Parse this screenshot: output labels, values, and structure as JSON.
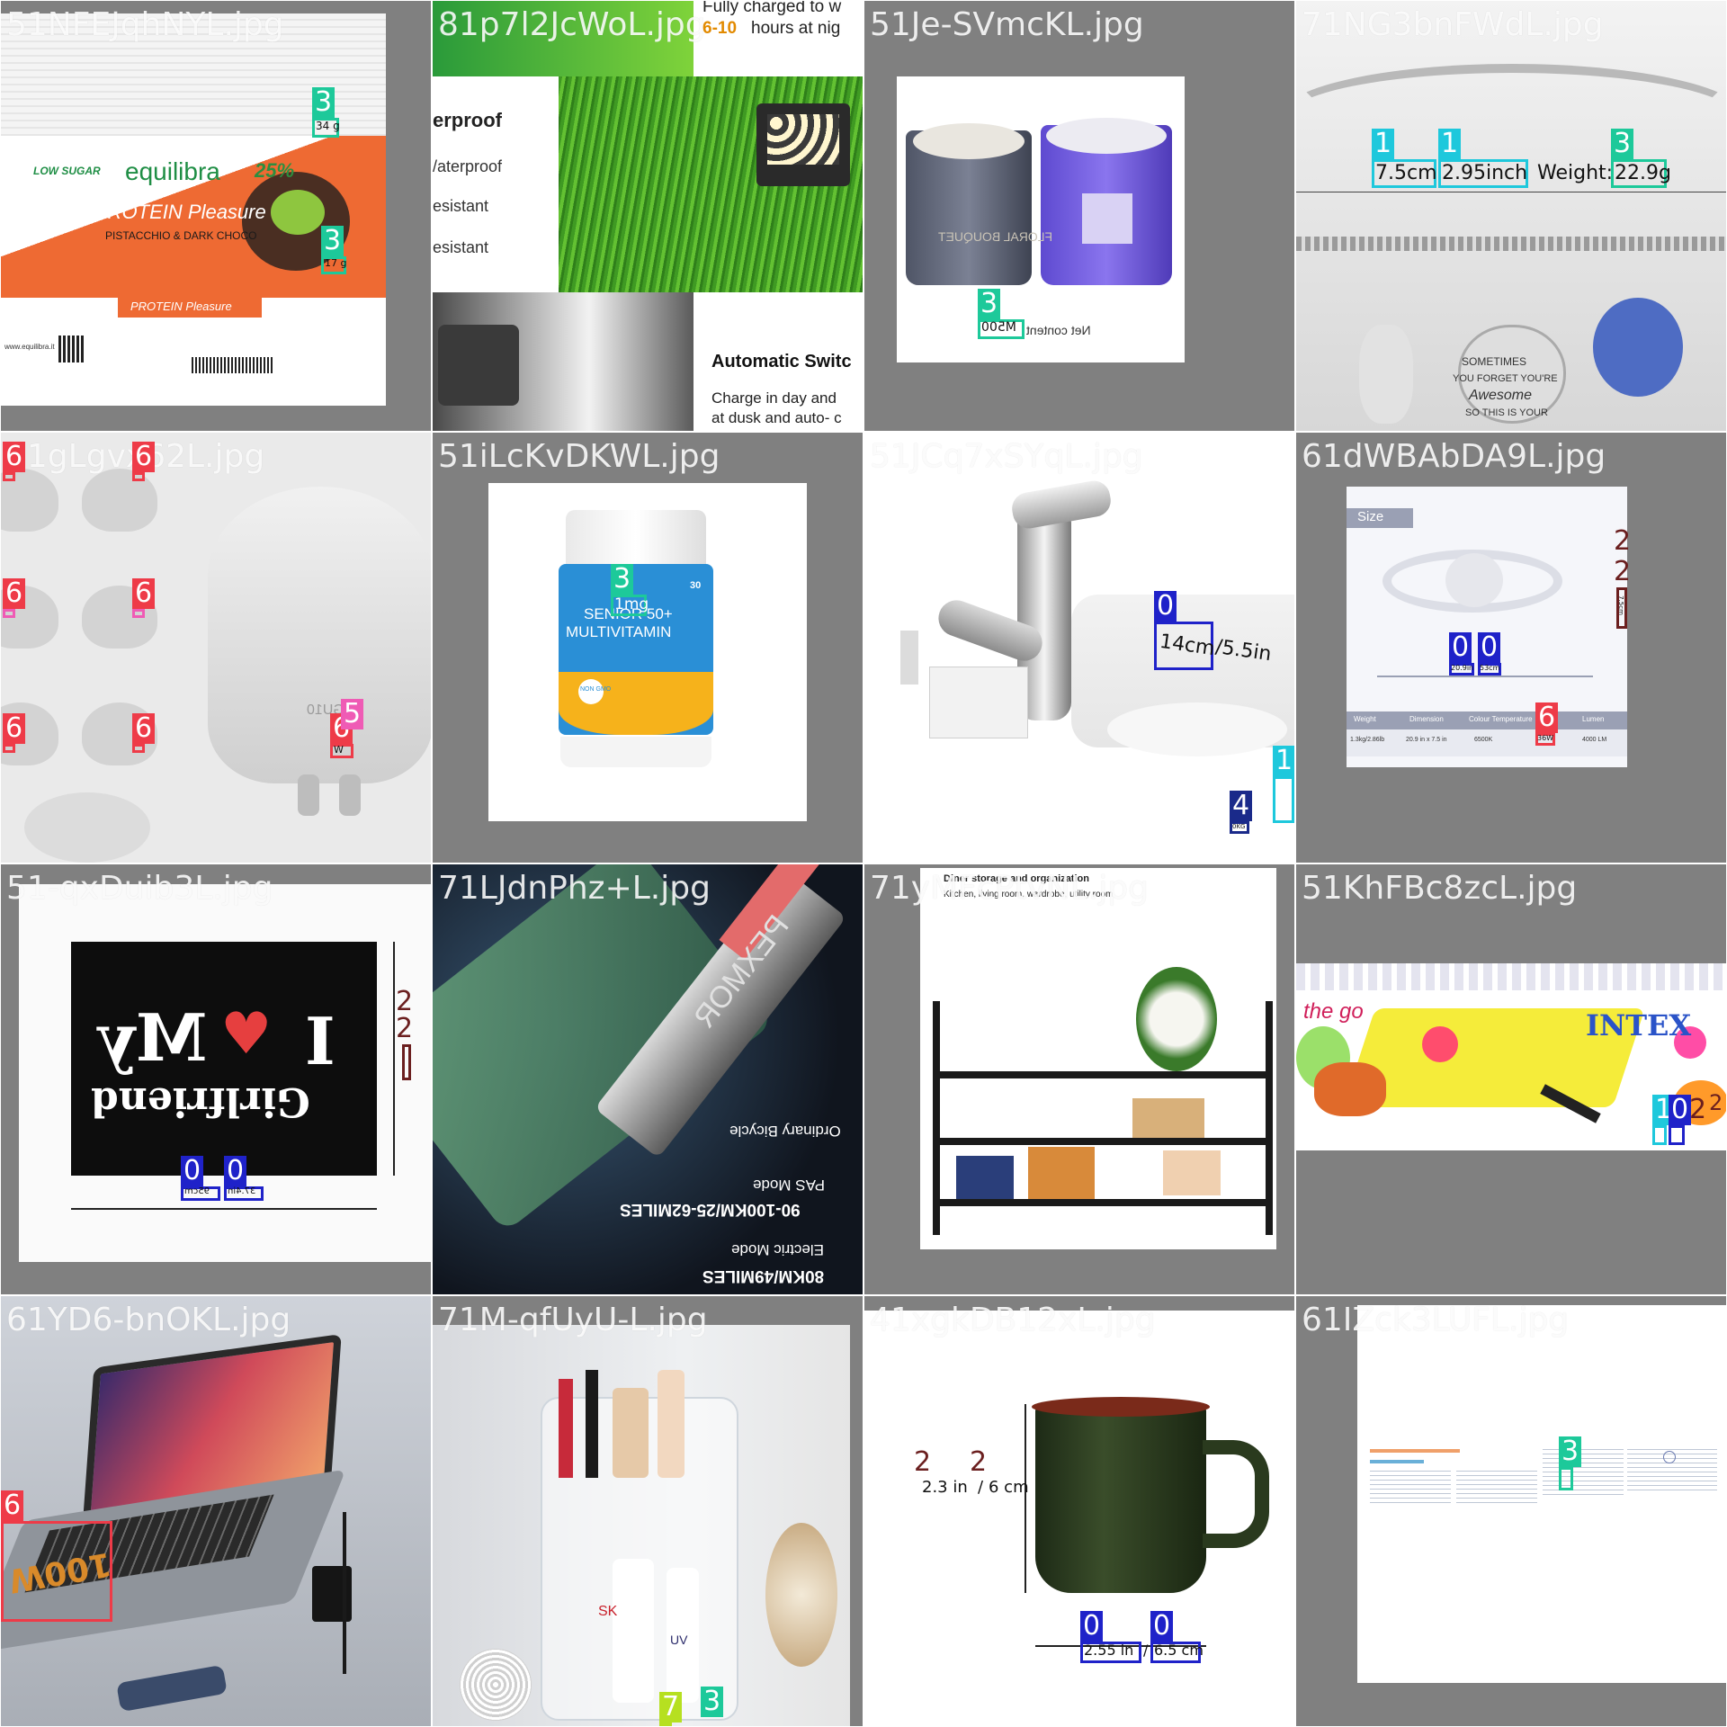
{
  "colors": {
    "class_0": "#1f22c9",
    "class_1": "#1ec8dc",
    "class_2": "#6b1f1f",
    "class_3": "#1dc99a",
    "class_4": "#1a2a8a",
    "class_6": "#ee3b48",
    "class_6_alt": "#ef5bb5",
    "class_7": "#b6e020",
    "tile_bg": "#808080"
  },
  "tiles": [
    {
      "filename": "51NFEJqhNYL.jpg",
      "texts": [
        "equilibra",
        "25%",
        "PROTEIN Pleasure",
        "PISTACCHIO & DARK CHOCO",
        "LOW SUGAR",
        "PROTEIN Pleasure",
        "www.equilibra.it"
      ],
      "annotations": [
        {
          "label": "3",
          "class": "class_3",
          "text": "34 g"
        },
        {
          "label": "3",
          "class": "class_3",
          "text": "17 g"
        }
      ]
    },
    {
      "filename": "81p7l2JcWoL.jpg",
      "texts": [
        "Fully charged to w",
        "6-10",
        "hours at nig",
        "erproof",
        "/aterproof",
        "esistant",
        "esistant",
        "Automatic Switc",
        "Charge in day and",
        "at dusk and auto- c"
      ],
      "annotations": []
    },
    {
      "filename": "51Je-SVmcKL.jpg",
      "texts": [
        "FLORAL BOUQUET"
      ],
      "annotations": [
        {
          "label": "3",
          "class": "class_3",
          "text": "M500"
        },
        {
          "label": "",
          "class": "",
          "text": "Net content"
        }
      ]
    },
    {
      "filename": "71NG3bnFWdL.jpg",
      "texts": [
        "SOMETIMES",
        "YOU FORGET YOU'RE",
        "Awesome",
        "SO THIS IS YOUR"
      ],
      "annotations": [
        {
          "label": "1",
          "class": "class_1",
          "text": "7.5cm"
        },
        {
          "label": "1",
          "class": "class_1",
          "text": "2.95inch"
        },
        {
          "label": "",
          "class": "",
          "text": "Weight:"
        },
        {
          "label": "3",
          "class": "class_3",
          "text": "22.9g"
        }
      ]
    },
    {
      "filename": "61gLgvx62L.jpg",
      "texts": [
        "GU10"
      ],
      "annotations": [
        {
          "label": "6",
          "class": "class_6",
          "text": ""
        },
        {
          "label": "6",
          "class": "class_6",
          "text": ""
        },
        {
          "label": "6",
          "class": "class_6",
          "text": ""
        },
        {
          "label": "6",
          "class": "class_6",
          "text": ""
        },
        {
          "label": "6",
          "class": "class_6",
          "text": ""
        },
        {
          "label": "6",
          "class": "class_6",
          "text": ""
        },
        {
          "label": "6",
          "class": "class_6",
          "text": "W"
        },
        {
          "label": "5",
          "class": "class_6_alt",
          "text": ""
        }
      ]
    },
    {
      "filename": "51iLcKvDKWL.jpg",
      "texts": [
        "SENIOR 50+",
        "MULTIVITAMIN",
        "30",
        "NON GMO"
      ],
      "annotations": [
        {
          "label": "3",
          "class": "class_3",
          "text": "1mg"
        }
      ]
    },
    {
      "filename": "51JCq7xSYqL.jpg",
      "texts": [],
      "annotations": [
        {
          "label": "0",
          "class": "class_0",
          "text": "14cm"
        },
        {
          "label": "",
          "class": "",
          "text": "/5.5in"
        },
        {
          "label": "1",
          "class": "class_1",
          "text": ""
        },
        {
          "label": "4",
          "class": "class_4",
          "text": "0KG"
        }
      ]
    },
    {
      "filename": "61dWBAbDA9L.jpg",
      "texts": [
        "Size",
        "Weight",
        "Dimension",
        "Colour Temperature",
        "Lumen",
        "1.3kg/2.86lb",
        "20.9 in x 7.5 in",
        "6500K",
        "4000 LM"
      ],
      "annotations": [
        {
          "label": "2",
          "class": "class_2",
          "text": ""
        },
        {
          "label": "2",
          "class": "class_2",
          "text": "7.5cm"
        },
        {
          "label": "0",
          "class": "class_0",
          "text": "20.9in"
        },
        {
          "label": "0",
          "class": "class_0",
          "text": "53cm"
        },
        {
          "label": "6",
          "class": "class_6",
          "text": "36W"
        }
      ]
    },
    {
      "filename": "51-qxDuib3L.jpg",
      "texts": [
        "I",
        "My",
        "Girlfriend"
      ],
      "annotations": [
        {
          "label": "2",
          "class": "class_2",
          "text": ""
        },
        {
          "label": "2",
          "class": "class_2",
          "text": ""
        },
        {
          "label": "0",
          "class": "class_0",
          "text": "95cm"
        },
        {
          "label": "0",
          "class": "class_0",
          "text": "37.4in"
        }
      ]
    },
    {
      "filename": "71LJdnPhz+L.jpg",
      "texts": [
        "PEXMOR",
        "Ordinary Bicycle",
        "PAS Mode",
        "90-100KM/25-62MILES",
        "Electric Mode",
        "80KM/49MILES"
      ],
      "annotations": []
    },
    {
      "filename": "71yMFcPtvNL.jpg",
      "texts": [
        "Diner storage and organization",
        "Kitchen, living room, wardrobe, utility room"
      ],
      "annotations": []
    },
    {
      "filename": "51KhFBc8zcL.jpg",
      "texts": [
        "the go",
        "INTEX"
      ],
      "annotations": [
        {
          "label": "1",
          "class": "class_1",
          "text": ""
        },
        {
          "label": "0",
          "class": "class_0",
          "text": ""
        },
        {
          "label": "2",
          "class": "class_2",
          "text": ""
        },
        {
          "label": "2",
          "class": "class_2",
          "text": ""
        }
      ]
    },
    {
      "filename": "61YD6-bnOKL.jpg",
      "texts": [],
      "annotations": [
        {
          "label": "6",
          "class": "class_6",
          "text": "100W"
        }
      ]
    },
    {
      "filename": "71M-qfUyU-L.jpg",
      "texts": [
        "SK",
        "UV"
      ],
      "annotations": [
        {
          "label": "7",
          "class": "class_7",
          "text": ""
        },
        {
          "label": "3",
          "class": "class_3",
          "text": ""
        }
      ]
    },
    {
      "filename": "41xgkDB12xL.jpg",
      "texts": [],
      "annotations": [
        {
          "label": "2",
          "class": "class_2",
          "text": "2.3 in"
        },
        {
          "label": "",
          "class": "",
          "text": "/"
        },
        {
          "label": "2",
          "class": "class_2",
          "text": "6 cm"
        },
        {
          "label": "0",
          "class": "class_0",
          "text": "2.55 in"
        },
        {
          "label": "",
          "class": "",
          "text": "/"
        },
        {
          "label": "0",
          "class": "class_0",
          "text": "6.5 cm"
        }
      ]
    },
    {
      "filename": "61IZck3LUFL.jpg",
      "texts": [],
      "annotations": [
        {
          "label": "3",
          "class": "class_3",
          "text": ""
        }
      ]
    }
  ]
}
